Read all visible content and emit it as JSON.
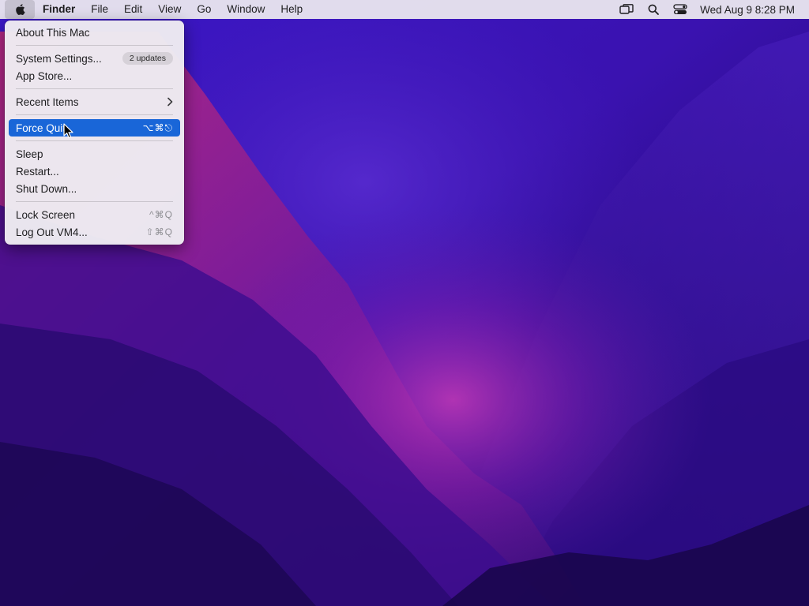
{
  "menubar": {
    "apple_icon": "apple-logo-icon",
    "app_name": "Finder",
    "menus": [
      "File",
      "Edit",
      "View",
      "Go",
      "Window",
      "Help"
    ],
    "status_icons": [
      "screen-mirroring-icon",
      "search-icon",
      "control-center-icon"
    ],
    "clock": "Wed Aug 9  8:28 PM"
  },
  "apple_menu": {
    "about": "About This Mac",
    "system_settings": "System Settings...",
    "updates_badge": "2 updates",
    "app_store": "App Store...",
    "recent_items": "Recent Items",
    "force_quit": "Force Quit",
    "force_quit_shortcut": "⌥⌘⎋",
    "sleep": "Sleep",
    "restart": "Restart...",
    "shut_down": "Shut Down...",
    "lock_screen": "Lock Screen",
    "lock_screen_shortcut": "^⌘Q",
    "log_out": "Log Out VM4...",
    "log_out_shortcut": "⇧⌘Q",
    "highlighted_item": "force_quit"
  },
  "colors": {
    "highlight": "#1966d8",
    "wallpaper_base": "#2a0e78"
  }
}
